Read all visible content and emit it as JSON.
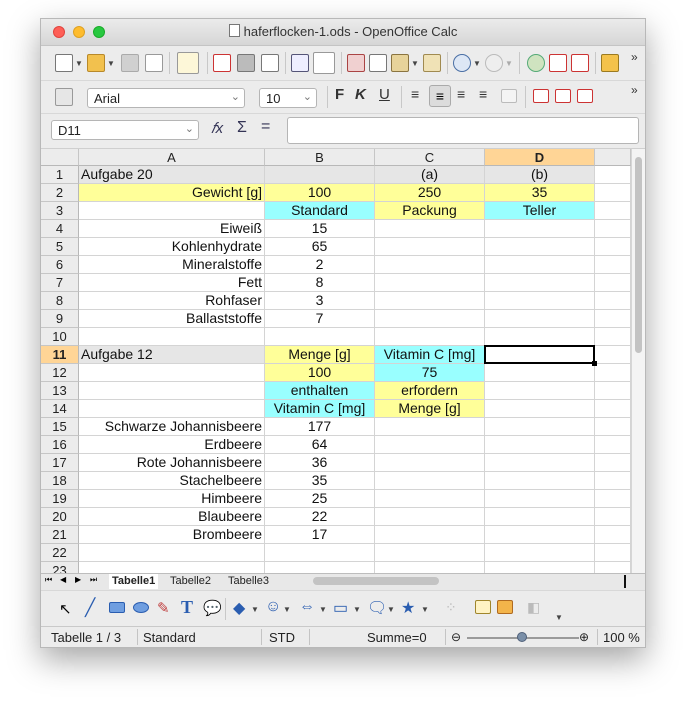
{
  "window": {
    "title": "haferflocken-1.ods - OpenOffice Calc"
  },
  "format_bar": {
    "font_name": "Arial",
    "font_size": "10"
  },
  "formula_bar": {
    "name_box": "D11",
    "content": ""
  },
  "columns": [
    "A",
    "B",
    "C",
    "D"
  ],
  "active_cell": {
    "col": "D",
    "row": "11"
  },
  "rows": [
    {
      "n": "1",
      "a": "Aufgabe 20",
      "b": "",
      "c": "(a)",
      "d": "(b)"
    },
    {
      "n": "2",
      "a": "Gewicht [g]",
      "b": "100",
      "c": "250",
      "d": "35"
    },
    {
      "n": "3",
      "a": "",
      "b": "Standard",
      "c": "Packung",
      "d": "Teller"
    },
    {
      "n": "4",
      "a": "Eiweiß",
      "b": "15",
      "c": "",
      "d": ""
    },
    {
      "n": "5",
      "a": "Kohlenhydrate",
      "b": "65",
      "c": "",
      "d": ""
    },
    {
      "n": "6",
      "a": "Mineralstoffe",
      "b": "2",
      "c": "",
      "d": ""
    },
    {
      "n": "7",
      "a": "Fett",
      "b": "8",
      "c": "",
      "d": ""
    },
    {
      "n": "8",
      "a": "Rohfaser",
      "b": "3",
      "c": "",
      "d": ""
    },
    {
      "n": "9",
      "a": "Ballaststoffe",
      "b": "7",
      "c": "",
      "d": ""
    },
    {
      "n": "10",
      "a": "",
      "b": "",
      "c": "",
      "d": ""
    },
    {
      "n": "11",
      "a": "Aufgabe 12",
      "b": "Menge [g]",
      "c": "Vitamin C [mg]",
      "d": ""
    },
    {
      "n": "12",
      "a": "",
      "b": "100",
      "c": "75",
      "d": ""
    },
    {
      "n": "13",
      "a": "",
      "b": "enthalten",
      "c": "erfordern",
      "d": ""
    },
    {
      "n": "14",
      "a": "",
      "b": "Vitamin C [mg]",
      "c": "Menge [g]",
      "d": ""
    },
    {
      "n": "15",
      "a": "Schwarze Johannisbeere",
      "b": "177",
      "c": "",
      "d": ""
    },
    {
      "n": "16",
      "a": "Erdbeere",
      "b": "64",
      "c": "",
      "d": ""
    },
    {
      "n": "17",
      "a": "Rote Johannisbeere",
      "b": "36",
      "c": "",
      "d": ""
    },
    {
      "n": "18",
      "a": "Stachelbeere",
      "b": "35",
      "c": "",
      "d": ""
    },
    {
      "n": "19",
      "a": "Himbeere",
      "b": "25",
      "c": "",
      "d": ""
    },
    {
      "n": "20",
      "a": "Blaubeere",
      "b": "22",
      "c": "",
      "d": ""
    },
    {
      "n": "21",
      "a": "Brombeere",
      "b": "17",
      "c": "",
      "d": ""
    },
    {
      "n": "22",
      "a": "",
      "b": "",
      "c": "",
      "d": ""
    },
    {
      "n": "23",
      "a": "",
      "b": "",
      "c": "",
      "d": ""
    }
  ],
  "sheet_tabs": [
    "Tabelle1",
    "Tabelle2",
    "Tabelle3"
  ],
  "status_bar": {
    "sheet": "Tabelle 1 / 3",
    "style": "Standard",
    "mode": "STD",
    "sum": "Summe=0",
    "zoom": "100 %"
  },
  "colors": {
    "highlight_yellow": "#ffff99",
    "highlight_cyan": "#99ffff",
    "header_active": "#ffd596"
  }
}
